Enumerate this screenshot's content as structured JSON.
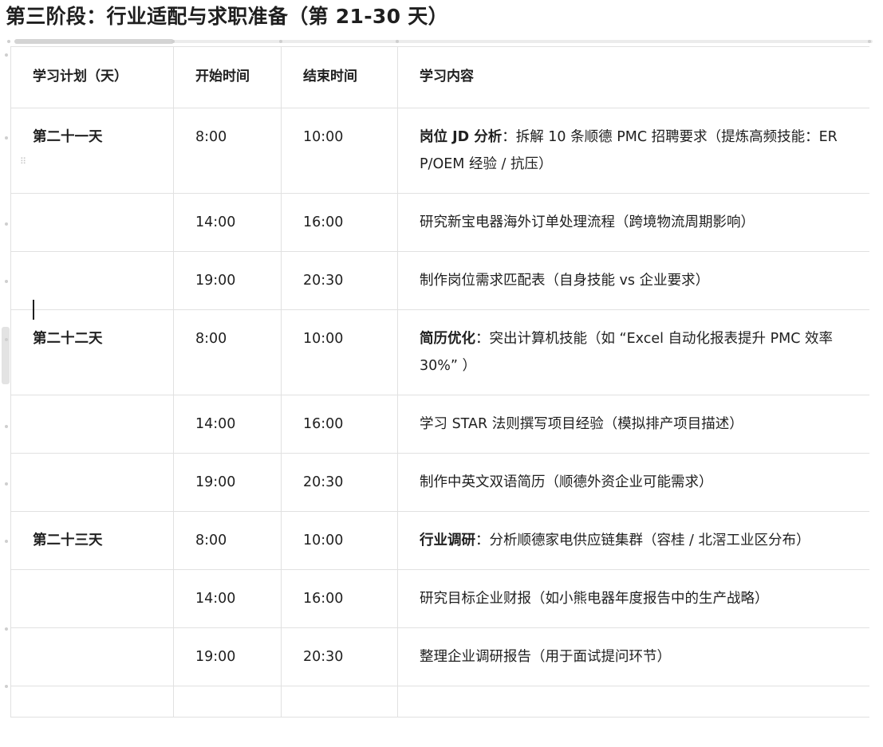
{
  "heading": "第三阶段：行业适配与求职准备（第 21-30 天）",
  "table": {
    "headers": [
      "学习计划（天）",
      "开始时间",
      "结束时间",
      "学习内容"
    ],
    "rows": [
      {
        "day": "第二十一天",
        "start": "8:00",
        "end": "10:00",
        "content_bold": "岗位 JD 分析",
        "content": "：拆解 10 条顺德 PMC 招聘要求（提炼高频技能：ERP/OEM 经验 / 抗压）"
      },
      {
        "day": "",
        "start": "14:00",
        "end": "16:00",
        "content_bold": "",
        "content": "研究新宝电器海外订单处理流程（跨境物流周期影响）"
      },
      {
        "day": "",
        "start": "19:00",
        "end": "20:30",
        "content_bold": "",
        "content": "制作岗位需求匹配表（自身技能 vs 企业要求）"
      },
      {
        "day": "第二十二天",
        "start": "8:00",
        "end": "10:00",
        "content_bold": "简历优化",
        "content": "：突出计算机技能（如 “Excel 自动化报表提升 PMC 效率 30%” ）"
      },
      {
        "day": "",
        "start": "14:00",
        "end": "16:00",
        "content_bold": "",
        "content": "学习 STAR 法则撰写项目经验（模拟排产项目描述）"
      },
      {
        "day": "",
        "start": "19:00",
        "end": "20:30",
        "content_bold": "",
        "content": "制作中英文双语简历（顺德外资企业可能需求）"
      },
      {
        "day": "第二十三天",
        "start": "8:00",
        "end": "10:00",
        "content_bold": "行业调研",
        "content": "：分析顺德家电供应链集群（容桂 / 北滘工业区分布）"
      },
      {
        "day": "",
        "start": "14:00",
        "end": "16:00",
        "content_bold": "",
        "content": "研究目标企业财报（如小熊电器年度报告中的生产战略）"
      },
      {
        "day": "",
        "start": "19:00",
        "end": "20:30",
        "content_bold": "",
        "content": "整理企业调研报告（用于面试提问环节）"
      },
      {
        "day": "",
        "start": "",
        "end": "",
        "content_bold": "",
        "content": ""
      }
    ]
  },
  "icons": {
    "row_drag": "drag-handle-icon",
    "text_cursor": "text-caret"
  },
  "colors": {
    "border": "#e1e1e1",
    "text": "#1f1f1f",
    "scrollbar": "#d4d4d4"
  }
}
